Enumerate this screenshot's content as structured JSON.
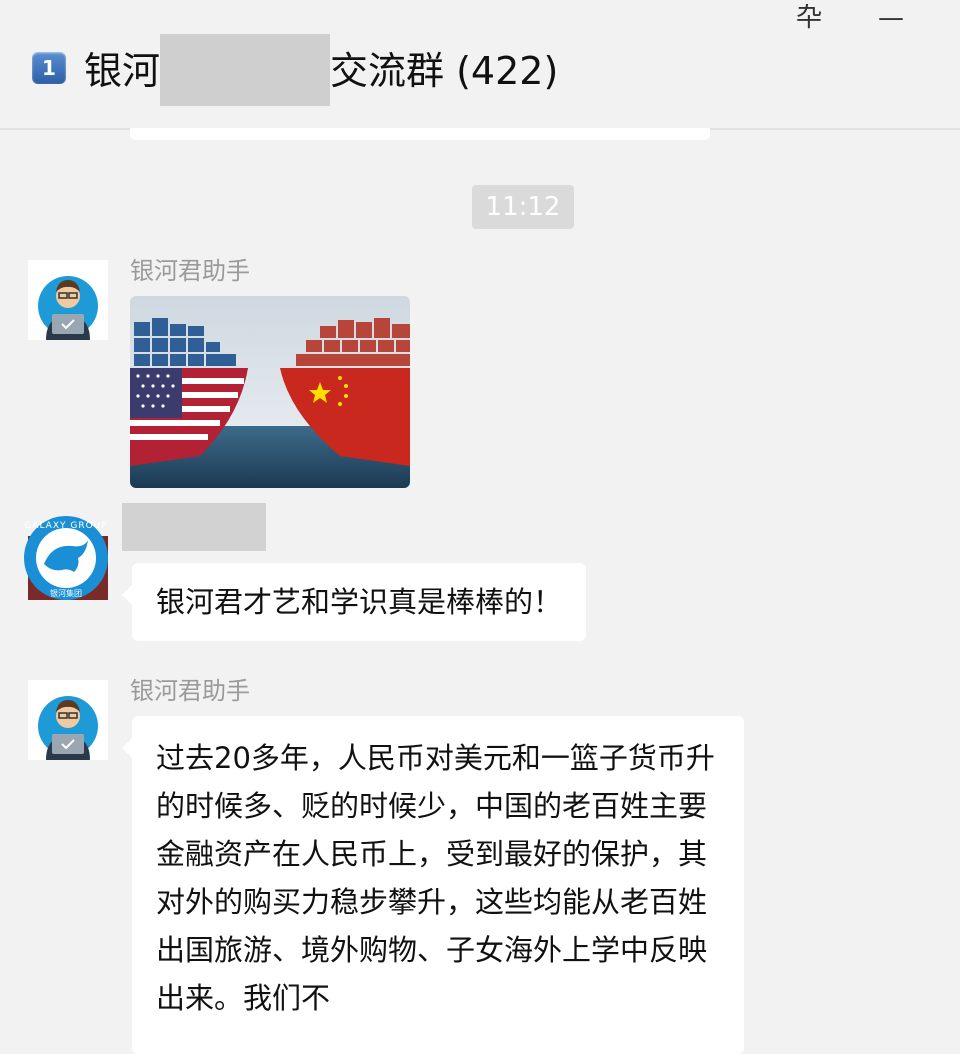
{
  "window": {
    "pin_icon": "pin-icon",
    "minimize_icon": "minimize-icon",
    "pin_glyph": "卆",
    "minimize_glyph": "—"
  },
  "header": {
    "badge": "1",
    "title_prefix": "银河",
    "title_suffix": "交流群 (422)"
  },
  "timestamp": "11:12",
  "messages": [
    {
      "sender": "银河君助手",
      "type": "image",
      "image_desc_icon": "trade-ships-image"
    },
    {
      "sender": "",
      "type": "text",
      "text": "银河君才艺和学识真是棒棒的！"
    },
    {
      "sender": "银河君助手",
      "type": "text",
      "text": "过去20多年，人民币对美元和一篮子货币升的时候多、贬的时候少，中国的老百姓主要金融资产在人民币上，受到最好的保护，其对外的购买力稳步攀升，这些均能从老百姓出国旅游、境外购物、子女海外上学中反映出来。我们不"
    }
  ],
  "galaxy_logo": {
    "ring_text": "GALAXY GROUP",
    "bottom_text": "银河集团"
  },
  "colors": {
    "bg": "#f2f2f2",
    "bubble": "#ffffff",
    "sender": "#9a9a9a",
    "time_bg": "#dadada",
    "logo_blue": "#1b8fd6"
  }
}
